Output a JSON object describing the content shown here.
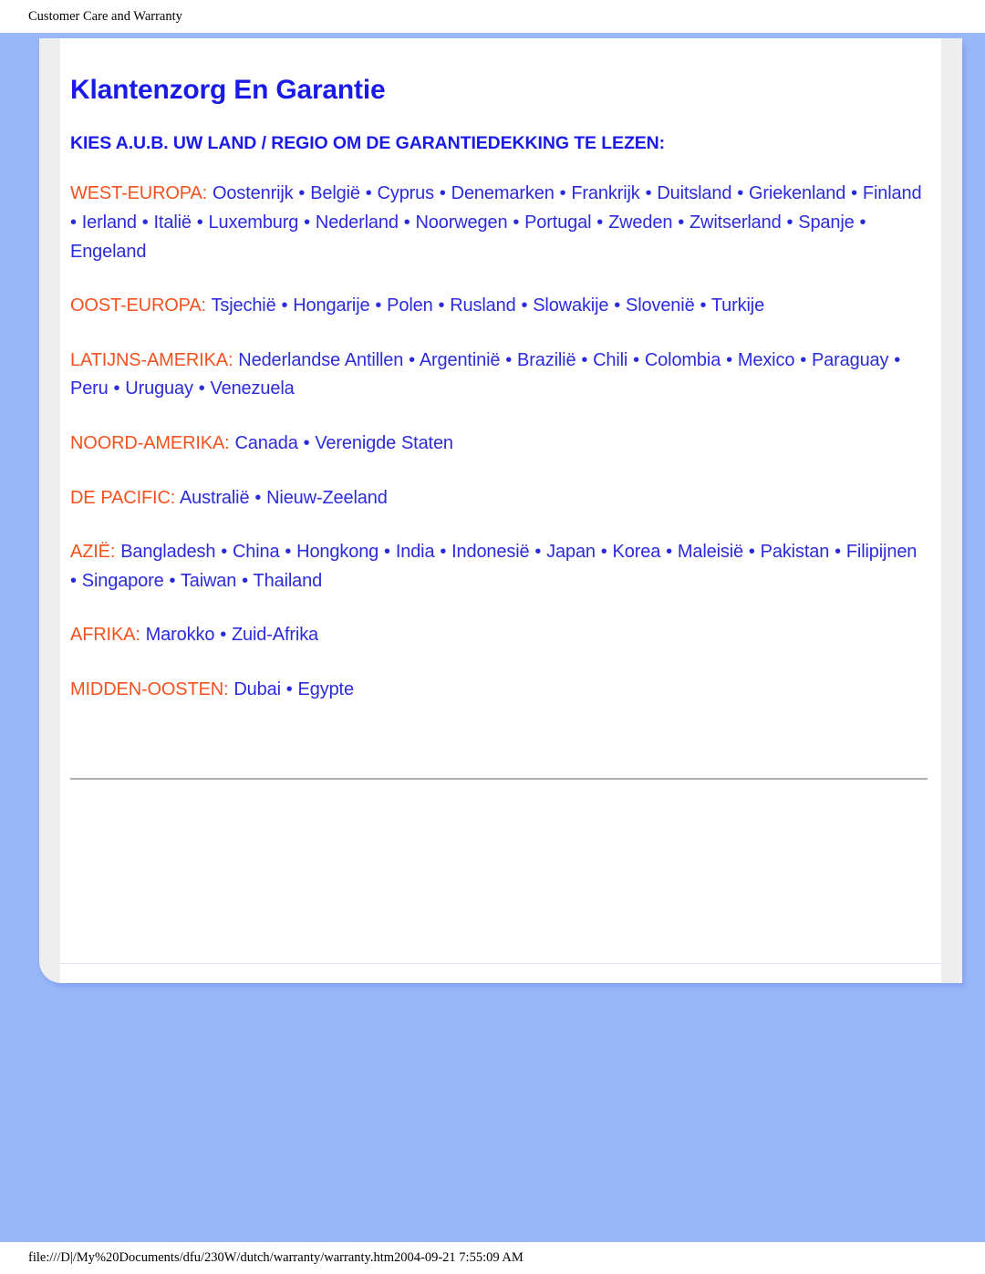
{
  "browser": {
    "header_title": "Customer Care and Warranty",
    "footer_path": "file:///D|/My%20Documents/dfu/230W/dutch/warranty/warranty.htm2004-09-21 7:55:09 AM"
  },
  "document": {
    "title": "Klantenzorg En Garantie",
    "instruction": "KIES A.U.B. UW LAND / REGIO OM DE GARANTIEDEKKING TE LEZEN:",
    "regions": [
      {
        "label": "WEST-EUROPA:",
        "countries": "Oostenrijk • België • Cyprus • Denemarken • Frankrijk • Duitsland • Griekenland • Finland • Ierland • Italië • Luxemburg • Nederland • Noorwegen • Portugal • Zweden • Zwitserland • Spanje • Engeland"
      },
      {
        "label": "OOST-EUROPA:",
        "countries": "Tsjechië • Hongarije • Polen • Rusland • Slowakije • Slovenië • Turkije"
      },
      {
        "label": "LATIJNS-AMERIKA:",
        "countries": "Nederlandse Antillen • Argentinië • Brazilië • Chili • Colombia • Mexico • Paraguay • Peru • Uruguay • Venezuela"
      },
      {
        "label": "NOORD-AMERIKA:",
        "countries": "Canada • Verenigde Staten"
      },
      {
        "label": "DE PACIFIC:",
        "countries": "Australië • Nieuw-Zeeland"
      },
      {
        "label": "AZIË:",
        "countries": "Bangladesh • China • Hongkong • India • Indonesië • Japan • Korea • Maleisië • Pakistan • Filipijnen • Singapore • Taiwan • Thailand"
      },
      {
        "label": "AFRIKA:",
        "countries": "Marokko • Zuid-Afrika"
      },
      {
        "label": "MIDDEN-OOSTEN:",
        "countries": "Dubai • Egypte"
      }
    ]
  },
  "colors": {
    "title_blue": "#1a1ae6",
    "body_blue": "#2b2bdd",
    "region_orange": "#f4511e",
    "page_blue": "#99b7f7",
    "gray_sheet": "#efeeee"
  }
}
